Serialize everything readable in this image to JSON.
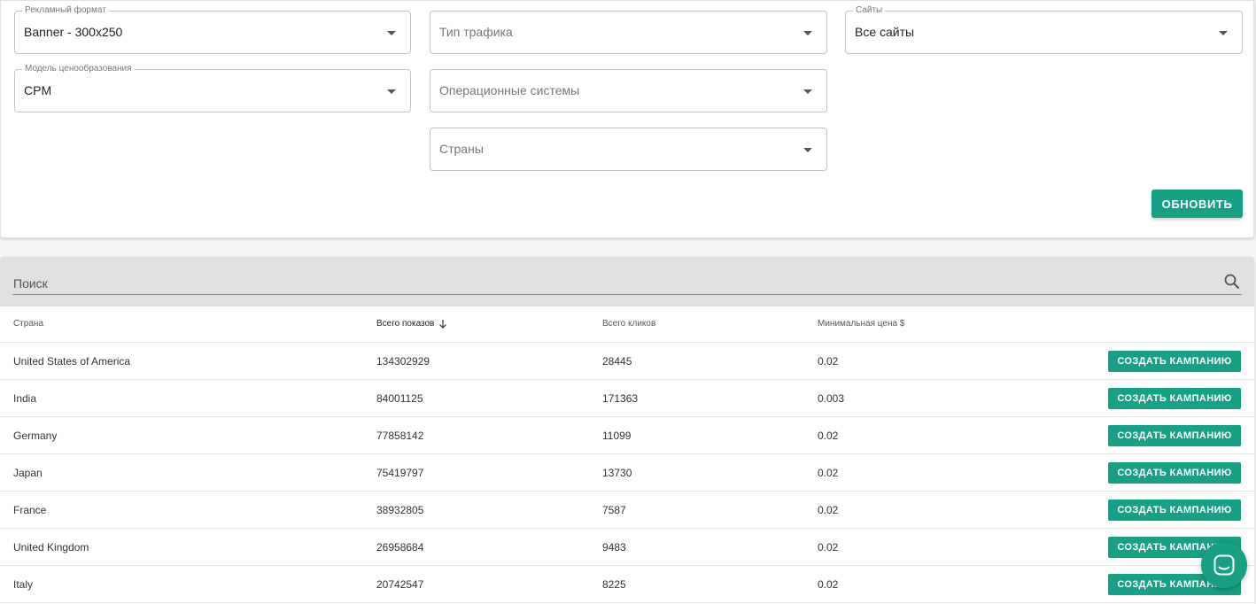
{
  "filters": {
    "ad_format": {
      "label": "Рекламный формат",
      "value": "Banner - 300x250"
    },
    "pricing_model": {
      "label": "Модель ценообразования",
      "value": "CPM"
    },
    "traffic_type": {
      "placeholder": "Тип трафика"
    },
    "operating_systems": {
      "placeholder": "Операционные системы"
    },
    "countries": {
      "placeholder": "Страны"
    },
    "sites": {
      "label": "Сайты",
      "value": "Все сайты"
    },
    "refresh_label": "ОБНОВИТЬ"
  },
  "search": {
    "placeholder": "Поиск"
  },
  "table": {
    "headers": {
      "country": "Страна",
      "impressions": "Всего показов",
      "clicks": "Всего кликов",
      "min_price": "Минимальная цена $"
    },
    "sorted_column": "impressions",
    "sort_direction": "desc",
    "action_label": "СОЗДАТЬ КАМПАНИЮ",
    "rows": [
      {
        "country": "United States of America",
        "impressions": "134302929",
        "clicks": "28445",
        "min_price": "0.02"
      },
      {
        "country": "India",
        "impressions": "84001125",
        "clicks": "171363",
        "min_price": "0.003"
      },
      {
        "country": "Germany",
        "impressions": "77858142",
        "clicks": "11099",
        "min_price": "0.02"
      },
      {
        "country": "Japan",
        "impressions": "75419797",
        "clicks": "13730",
        "min_price": "0.02"
      },
      {
        "country": "France",
        "impressions": "38932805",
        "clicks": "7587",
        "min_price": "0.02"
      },
      {
        "country": "United Kingdom",
        "impressions": "26958684",
        "clicks": "9483",
        "min_price": "0.02"
      },
      {
        "country": "Italy",
        "impressions": "20742547",
        "clicks": "8225",
        "min_price": "0.02"
      }
    ]
  },
  "colors": {
    "accent": "#16a084",
    "search_bar_bg": "#e0e0e0"
  },
  "icons": {
    "search": "search-icon",
    "sort": "arrow-down-icon",
    "chat": "chat-icon"
  }
}
